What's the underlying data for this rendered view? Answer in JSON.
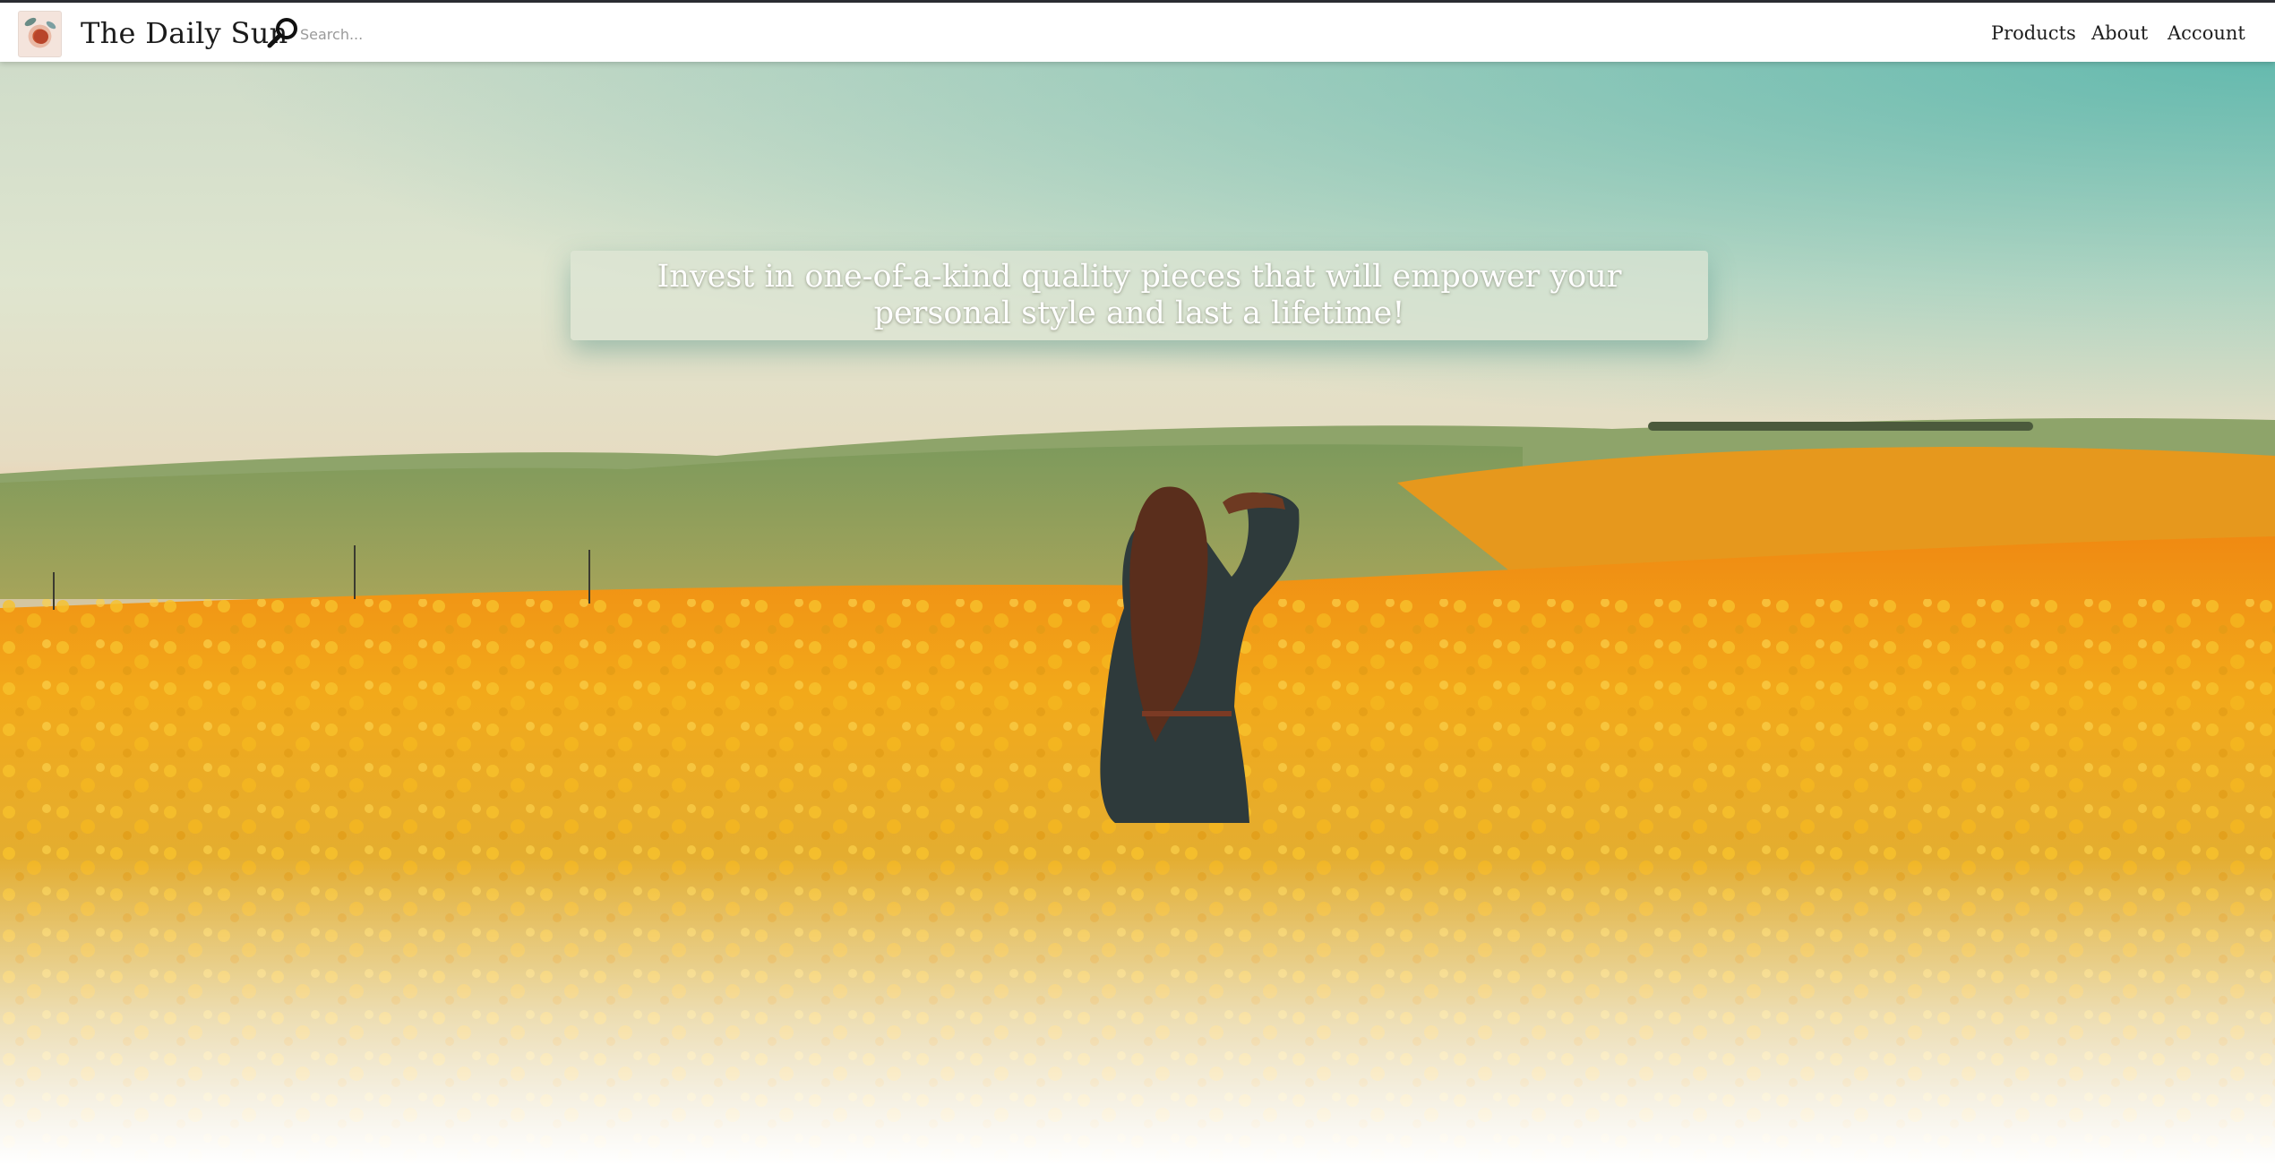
{
  "navbar": {
    "brand": "The Daily Sun",
    "logo_icon": "bouquet-logo-icon",
    "search_icon": "magnifier-icon",
    "search_placeholder": "Search...",
    "links": [
      {
        "label": "Products"
      },
      {
        "label": "About"
      },
      {
        "label": "Account"
      }
    ]
  },
  "hero": {
    "tagline": "Invest in one-of-a-kind quality pieces that will empower your personal style and last a lifetime!"
  },
  "colors": {
    "topline": "#2b2e33",
    "field_yellow": "#f2a91a",
    "sky_teal": "#7cc3b6"
  }
}
